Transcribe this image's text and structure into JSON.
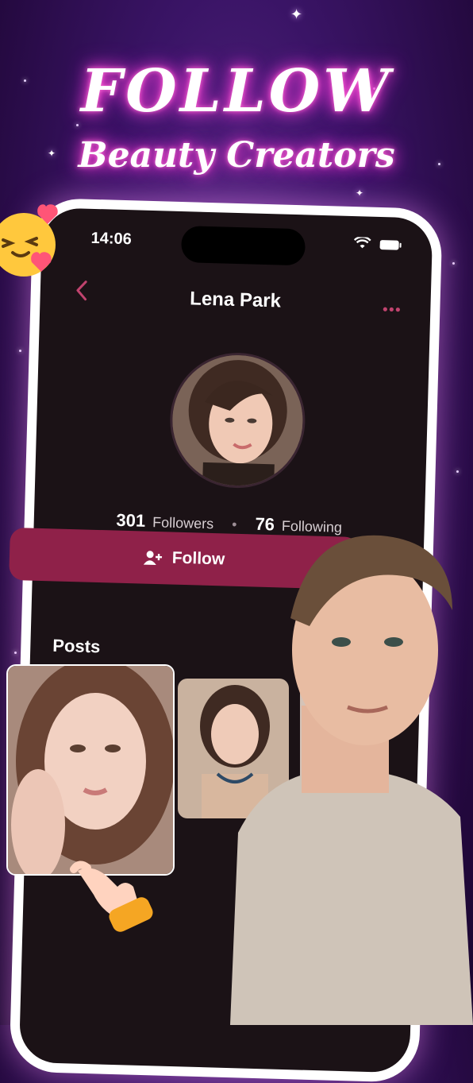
{
  "promo": {
    "headline": "FOLLOW",
    "subheadline": "Beauty Creators"
  },
  "status_bar": {
    "time": "14:06"
  },
  "profile": {
    "name": "Lena Park",
    "followers_count": "301",
    "followers_label": "Followers",
    "separator": "•",
    "following_count": "76",
    "following_label": "Following",
    "follow_button_label": "Follow",
    "posts_heading": "Posts"
  },
  "icons": {
    "back": "chevron-left-icon",
    "more": "more-dots-icon",
    "follow": "add-user-icon",
    "wifi": "wifi-icon",
    "battery": "battery-icon"
  },
  "colors": {
    "accent": "#8f2149",
    "accent_icon": "#c0436e",
    "background": "#1b1216",
    "glow": "#ff3fcf"
  }
}
